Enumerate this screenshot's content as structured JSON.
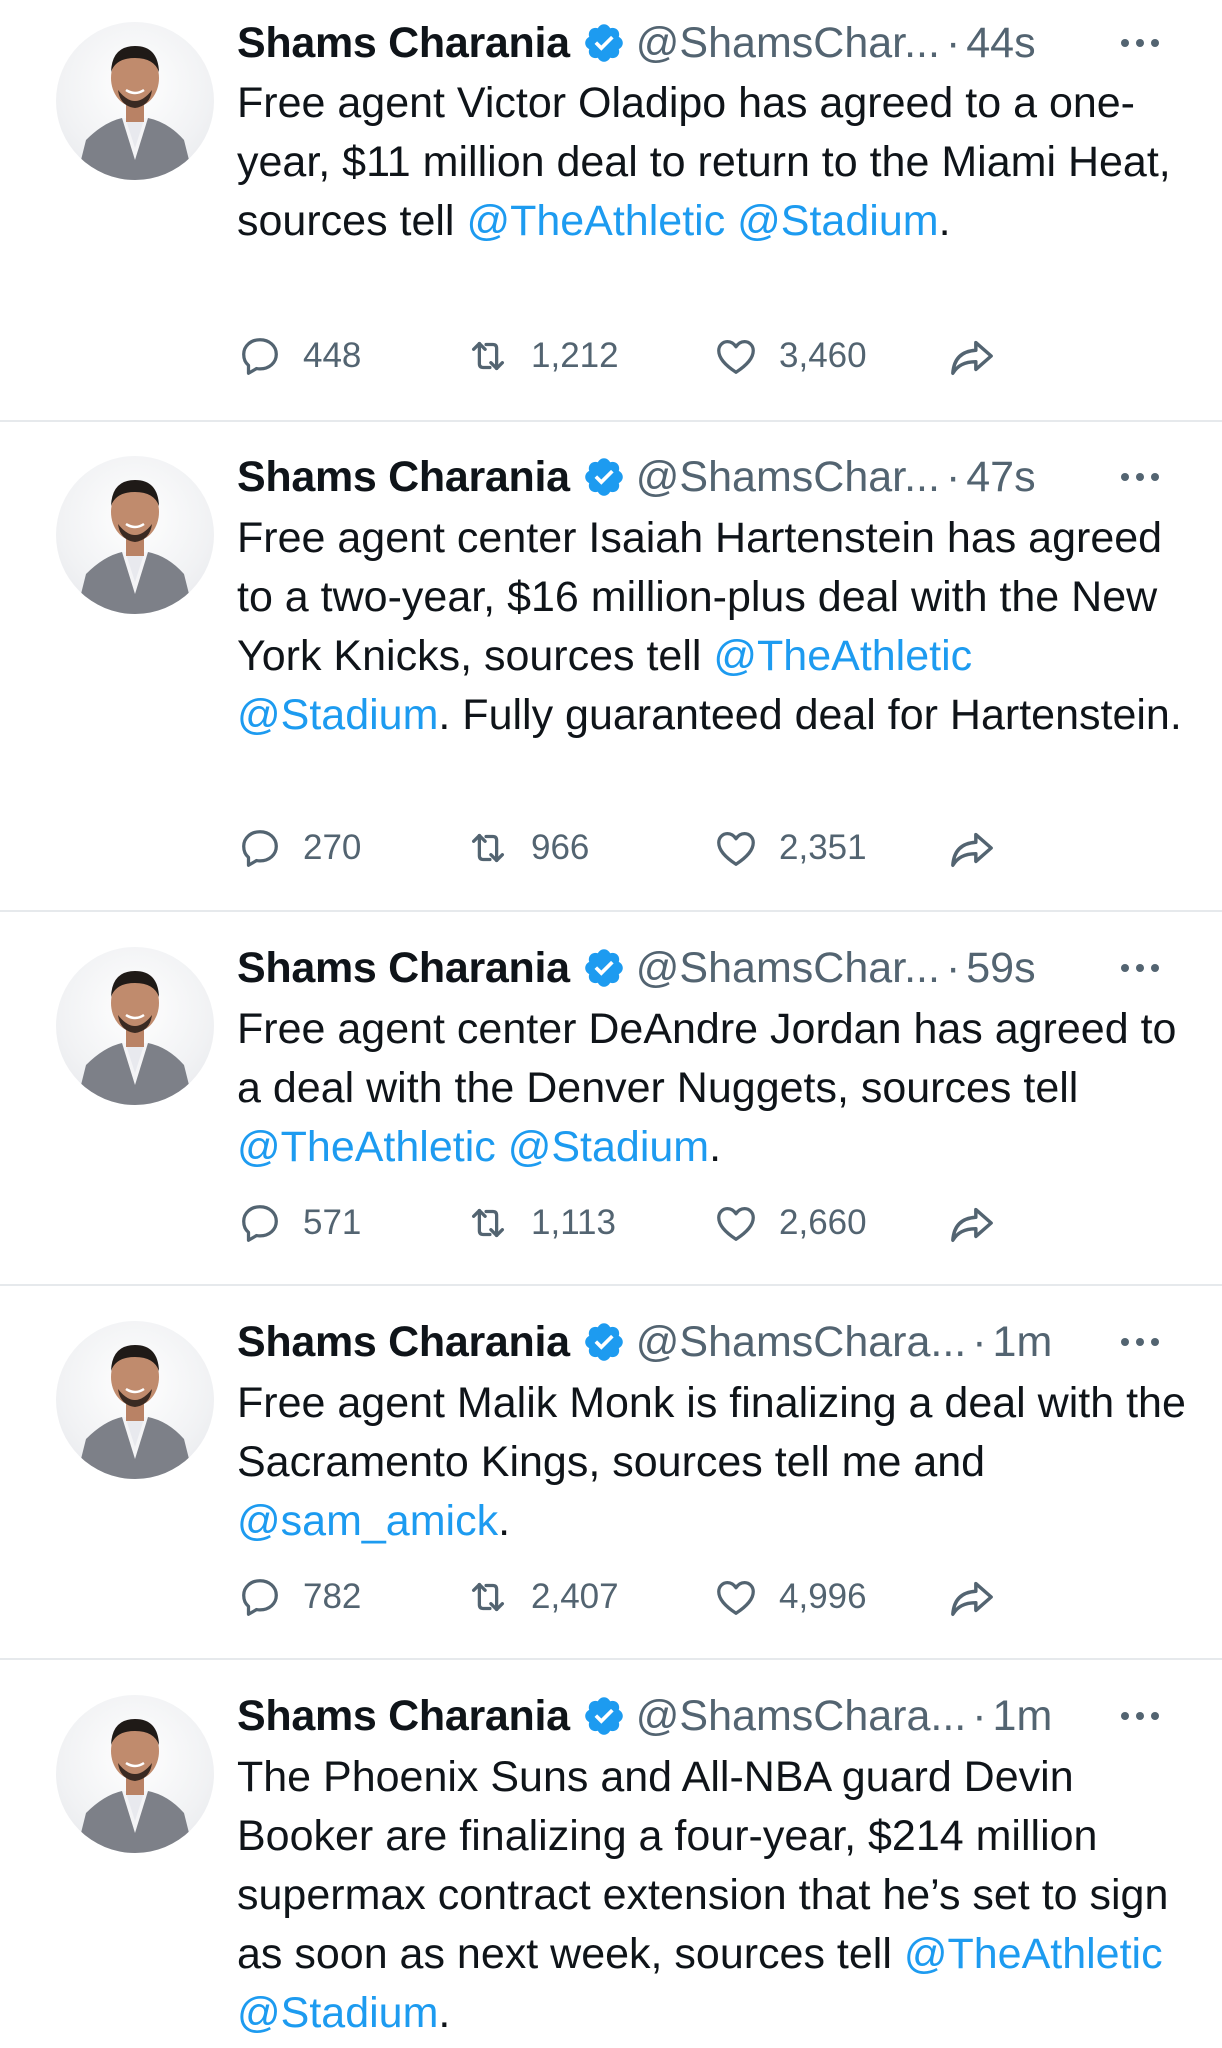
{
  "tweets": [
    {
      "name": "Shams Charania",
      "handle": "@ShamsChar...",
      "time": "44s",
      "text": [
        {
          "t": "Free agent Victor Oladipo has agreed to a one-year, $11 million deal to return to the Miami Heat, sources tell "
        },
        {
          "t": "@TheAthletic",
          "m": true
        },
        {
          "t": " "
        },
        {
          "t": "@Stadium",
          "m": true
        },
        {
          "t": "."
        }
      ],
      "replies": "448",
      "retweets": "1,212",
      "likes": "3,460"
    },
    {
      "name": "Shams Charania",
      "handle": "@ShamsChar...",
      "time": "47s",
      "text": [
        {
          "t": "Free agent center Isaiah Hartenstein has agreed to a two-year, $16 million-plus deal with the New York Knicks, sources tell "
        },
        {
          "t": "@TheAthletic",
          "m": true
        },
        {
          "t": " "
        },
        {
          "t": "@Stadium",
          "m": true
        },
        {
          "t": ". Fully guaranteed deal for Hartenstein."
        }
      ],
      "replies": "270",
      "retweets": "966",
      "likes": "2,351"
    },
    {
      "name": "Shams Charania",
      "handle": "@ShamsChar...",
      "time": "59s",
      "text": [
        {
          "t": "Free agent center DeAndre Jordan has agreed to a deal with the Denver Nuggets, sources tell "
        },
        {
          "t": "@TheAthletic",
          "m": true
        },
        {
          "t": " "
        },
        {
          "t": "@Stadium",
          "m": true
        },
        {
          "t": "."
        }
      ],
      "replies": "571",
      "retweets": "1,113",
      "likes": "2,660"
    },
    {
      "name": "Shams Charania",
      "handle": "@ShamsChara...",
      "time": "1m",
      "text": [
        {
          "t": "Free agent Malik Monk is finalizing a deal with the Sacramento Kings, sources tell me and "
        },
        {
          "t": "@sam_amick",
          "m": true
        },
        {
          "t": "."
        }
      ],
      "replies": "782",
      "retweets": "2,407",
      "likes": "4,996"
    },
    {
      "name": "Shams Charania",
      "handle": "@ShamsChara...",
      "time": "1m",
      "text": [
        {
          "t": "The Phoenix Suns and All-NBA guard Devin Booker are finalizing a four-year, $214 million supermax contract extension that he’s set to sign as soon as next week, sources tell "
        },
        {
          "t": "@TheAthletic",
          "m": true
        },
        {
          "t": " "
        },
        {
          "t": "@Stadium",
          "m": true
        },
        {
          "t": "."
        }
      ],
      "replies": "",
      "retweets": "",
      "likes": ""
    }
  ],
  "colors": {
    "text": "#0f1419",
    "secondary": "#536471",
    "mention": "#1d9bf0",
    "verified": "#1d9bf0",
    "divider": "#e6e9ec"
  },
  "icons": [
    "reply-icon",
    "retweet-icon",
    "like-icon",
    "share-icon",
    "verified-badge-icon",
    "more-icon"
  ]
}
